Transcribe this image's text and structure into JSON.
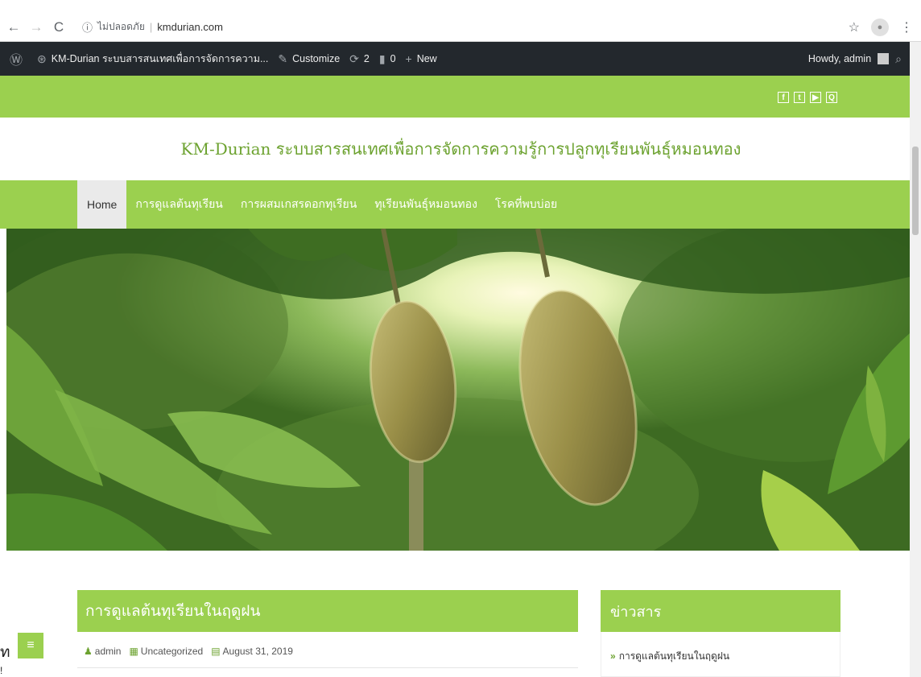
{
  "browser": {
    "not_secure_label": "ไม่ปลอดภัย",
    "url": "kmdurian.com",
    "back_icon": "arrow-left-icon",
    "forward_icon": "arrow-right-icon",
    "reload_icon": "reload-icon",
    "info_icon": "info-icon",
    "star_icon": "star-icon",
    "menu_icon": "kebab-menu-icon"
  },
  "admin_bar": {
    "site_name": "KM-Durian ระบบสารสนเทศเพื่อการจัดการความ...",
    "customize": "Customize",
    "updates_count": "2",
    "comments_count": "0",
    "new_label": "New",
    "howdy": "Howdy, admin"
  },
  "site": {
    "title": "KM-Durian ระบบสารสนเทศเพื่อการจัดการความรู้การปลูกทุเรียนพันธุ์หมอนทอง",
    "accent": "#9bd04f",
    "title_color": "#6ca22f"
  },
  "nav": {
    "items": [
      {
        "label": "Home",
        "active": true
      },
      {
        "label": "การดูแลต้นทุเรียน",
        "active": false
      },
      {
        "label": "การผสมเกสรดอกทุเรียน",
        "active": false
      },
      {
        "label": "ทุเรียนพันธุ์หมอนทอง",
        "active": false
      },
      {
        "label": "โรคที่พบบ่อย",
        "active": false
      }
    ]
  },
  "social": [
    "f",
    "t",
    "yt",
    "q"
  ],
  "post": {
    "title": "การดูแลต้นทุเรียนในฤดูฝน",
    "author": "admin",
    "category": "Uncategorized",
    "date": "August 31, 2019"
  },
  "sidebar": {
    "heading": "ข่าวสาร",
    "items": [
      "การดูแลต้นทุเรียนในฤดูฝน"
    ]
  },
  "edge_text": [
    "ท",
    "!"
  ]
}
